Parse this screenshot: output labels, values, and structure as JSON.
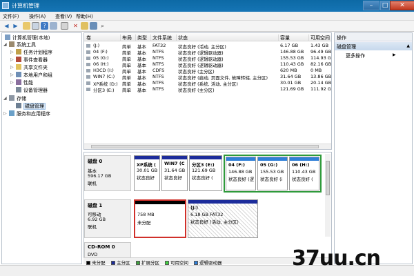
{
  "window": {
    "title": "计算机管理",
    "buttons": {
      "minimize": "–",
      "maximize": "□",
      "close": "✕"
    }
  },
  "menu": [
    "文件(F)",
    "操作(A)",
    "查看(V)",
    "帮助(H)"
  ],
  "toolbar": {
    "icons": [
      "back-icon",
      "forward-icon",
      "up-folder-icon",
      "properties-icon",
      "help-icon",
      "list-icon",
      "delete-icon",
      "open-icon",
      "save-icon",
      "search-icon",
      "grid-icon"
    ]
  },
  "tree": {
    "root": "计算机管理(本地)",
    "system_tools": "系统工具",
    "task_scheduler": "任务计划程序",
    "event_viewer": "事件查看器",
    "shared_folders": "共享文件夹",
    "local_users": "本地用户和组",
    "performance": "性能",
    "device_manager": "设备管理器",
    "storage": "存储",
    "disk_management": "磁盘管理",
    "services": "服务和应用程序"
  },
  "volume_table": {
    "headers": [
      "卷",
      "布局",
      "类型",
      "文件系统",
      "状态",
      "容量",
      "可用空间"
    ],
    "rows": [
      [
        "(J:)",
        "简单",
        "基本",
        "FAT32",
        "状态良好 (活动, 主分区)",
        "6.17 GB",
        "1.43 GB"
      ],
      [
        "04 (F:)",
        "简单",
        "基本",
        "NTFS",
        "状态良好 (逻辑驱动器)",
        "146.88 GB",
        "96.49 GB"
      ],
      [
        "05 (G:)",
        "简单",
        "基本",
        "NTFS",
        "状态良好 (逻辑驱动器)",
        "155.53 GB",
        "114.93 GB"
      ],
      [
        "06 (H:)",
        "简单",
        "基本",
        "NTFS",
        "状态良好 (逻辑驱动器)",
        "110.43 GB",
        "82.16 GB"
      ],
      [
        "H3CD (I:)",
        "简单",
        "基本",
        "CDFS",
        "状态良好 (主分区)",
        "620 MB",
        "0 MB"
      ],
      [
        "WIN7 (C:)",
        "简单",
        "基本",
        "NTFS",
        "状态良好 (启动, 页面文件, 故障转储, 主分区)",
        "31.64 GB",
        "13.86 GB"
      ],
      [
        "XP系统 (D:)",
        "简单",
        "基本",
        "NTFS",
        "状态良好 (系统, 活动, 主分区)",
        "30.01 GB",
        "20.14 GB"
      ],
      [
        "分区3 (E:)",
        "简单",
        "基本",
        "NTFS",
        "状态良好 (主分区)",
        "121.69 GB",
        "111.92 GB"
      ]
    ]
  },
  "disks": [
    {
      "name": "磁盘 0",
      "type": "基本",
      "size": "596.17 GB",
      "status": "联机",
      "partitions": [
        {
          "name": "XP系统 (",
          "size": "30.01 GB",
          "status": "状态良好",
          "color": "#1c2c9b"
        },
        {
          "name": "WIN7 (C",
          "size": "31.64 GB",
          "status": "状态良好",
          "color": "#1c2c9b"
        },
        {
          "name": "分区3 (E:)",
          "size": "121.69 GB",
          "status": "状态良好 (",
          "color": "#1c2c9b"
        },
        {
          "name": "04 (F:)",
          "size": "146.88 GB",
          "status": "状态良好 (逻",
          "color": "#1c2c9b"
        },
        {
          "name": "05 (G:)",
          "size": "155.53 GB",
          "status": "状态良好 (i",
          "color": "#1c2c9b"
        },
        {
          "name": "06 (H:)",
          "size": "110.43 GB",
          "status": "状态良好 (",
          "color": "#1c2c9b"
        }
      ]
    },
    {
      "name": "磁盘 1",
      "type": "可移动",
      "size": "6.92 GB",
      "status": "联机",
      "partitions": [
        {
          "name": "",
          "size": "758 MB",
          "status": "未分配",
          "color": "#000000"
        },
        {
          "name": "(J:)",
          "size": "6.18 GB FAT32",
          "status": "状态良好 (活动, 主分区)",
          "color": "#1c2c9b"
        }
      ]
    },
    {
      "name": "CD-ROM 0",
      "type": "DVD",
      "size": "",
      "status": "",
      "partitions": []
    }
  ],
  "legend": [
    {
      "label": "未分配",
      "color": "#000000"
    },
    {
      "label": "主分区",
      "color": "#1c2c9b"
    },
    {
      "label": "扩展分区",
      "color": "#3fa23f"
    },
    {
      "label": "可用空间",
      "color": "#3fd13f"
    },
    {
      "label": "逻辑驱动器",
      "color": "#2f7fd8"
    }
  ],
  "actions": {
    "header": "操作",
    "section": "磁盘管理",
    "more": "更多操作"
  },
  "watermark": "37uu.cn",
  "colors": {
    "title_bar": "#1675b5",
    "highlight_green": "#2e9a3a",
    "highlight_red": "#d0302a",
    "primary_partition": "#1c2c9b"
  }
}
